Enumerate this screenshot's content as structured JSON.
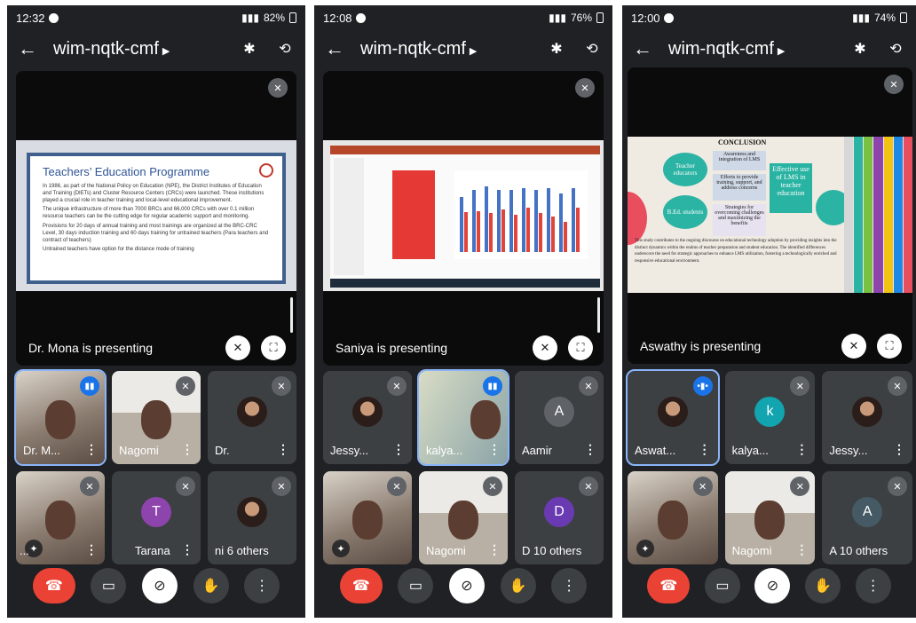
{
  "meeting_code": "wim-nqtk-cmf",
  "phones": [
    {
      "time": "12:32",
      "battery": "82%",
      "presenting": "Dr. Mona  is presenting",
      "slide": {
        "title": "Teachers’ Education Programme",
        "bullets": [
          "In 1986, as part of the National Policy on Education (NPE), the District Institutes of Education and Training (DIETs) and Cluster Resource Centers (CRCs) were launched. These institutions played a crucial role in teacher training and local-level educational improvement.",
          "The unique infrastructure of more than 7000 BRCs and 66,000 CRCs with over 0.1 million resource teachers can be the cutting edge for regular academic support and monitoring.",
          "Provisions for 20 days of annual training and most trainings are organized at the BRC-CRC Level, 30 days induction training and 60 days training for untrained teachers (Para teachers and contract of teachers)",
          "Untrained teachers have option for the distance mode of training"
        ]
      },
      "tiles": [
        {
          "name": "Dr. M...",
          "kind": "cam",
          "speaking": true
        },
        {
          "name": "Nagomi",
          "kind": "room"
        },
        {
          "name": "Dr.",
          "kind": "photo"
        },
        {
          "name": "...",
          "kind": "cam"
        },
        {
          "name": "Tarana",
          "kind": "letter",
          "letter": "T",
          "color": "#8e44ad"
        },
        {
          "name": "ni 6 others",
          "kind": "photo"
        }
      ]
    },
    {
      "time": "12:08",
      "battery": "76%",
      "presenting": "Saniya is presenting",
      "tiles": [
        {
          "name": "Jessy...",
          "kind": "photo"
        },
        {
          "name": "kalya...",
          "kind": "cam",
          "speaking": true
        },
        {
          "name": "Aamir",
          "kind": "letter",
          "letter": "A",
          "color": "#5f6368"
        },
        {
          "name": "",
          "kind": "cam"
        },
        {
          "name": "Nagomi",
          "kind": "room"
        },
        {
          "name": "D 10 others",
          "kind": "letter",
          "letter": "D",
          "color": "#6a3ab2"
        }
      ]
    },
    {
      "time": "12:00",
      "battery": "74%",
      "presenting": "Aswathy is presenting",
      "slide": {
        "title": "CONCLUSION",
        "bubbles": [
          "Teacher educators",
          "B.Ed. students"
        ],
        "boxes": [
          "Awareness and integration of LMS",
          "Efforts to provide training, support, and address concerns",
          "Strategies for overcoming challenges and maximizing the benefits"
        ],
        "effective": "Effective use of LMS in teacher education",
        "body": "This study contributes to the ongoing discourse on educational technology adoption by providing insights into the distinct dynamics within the realms of teacher preparation and student education. The identified differences underscore the need for strategic approaches to enhance LMS utilization, fostering a technologically enriched and responsive educational environment."
      },
      "tiles": [
        {
          "name": "Aswat...",
          "kind": "photo",
          "speaking": true
        },
        {
          "name": "kalya...",
          "kind": "letter",
          "letter": "k",
          "color": "#12a4af"
        },
        {
          "name": "Jessy...",
          "kind": "photo"
        },
        {
          "name": "",
          "kind": "cam"
        },
        {
          "name": "Nagomi",
          "kind": "room"
        },
        {
          "name": "A 10 others",
          "kind": "letter",
          "letter": "A",
          "color": "#455a64"
        }
      ]
    }
  ],
  "icons": {
    "back": "arrow-left-icon",
    "bluetooth": "bluetooth-icon",
    "switch_camera": "switch-camera-icon",
    "mic_off": "mic-off-icon",
    "end_call": "end-call-icon",
    "camera": "camera-icon",
    "raise_hand": "raise-hand-icon",
    "more": "more-vert-icon"
  },
  "chart_bars": [
    [
      62,
      45
    ],
    [
      70,
      46
    ],
    [
      74,
      44
    ],
    [
      70,
      48
    ],
    [
      70,
      42
    ],
    [
      72,
      50
    ],
    [
      70,
      44
    ],
    [
      72,
      40
    ],
    [
      66,
      34
    ],
    [
      72,
      50
    ]
  ]
}
